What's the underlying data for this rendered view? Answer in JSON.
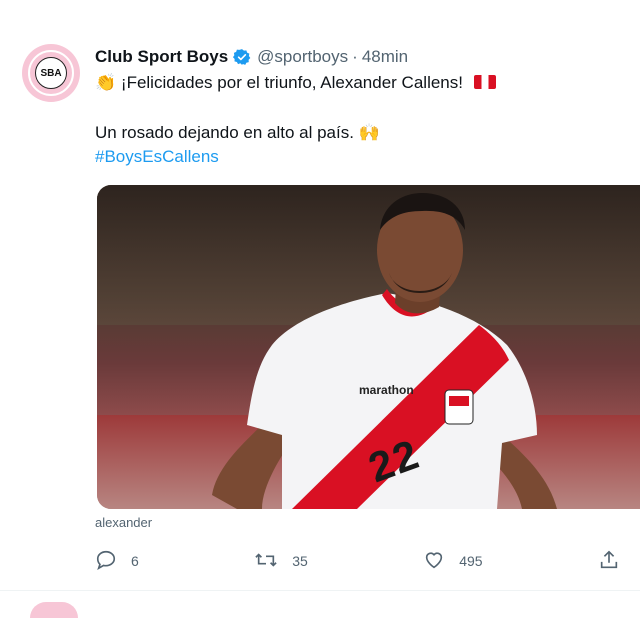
{
  "tweet": {
    "author_name": "Club Sport Boys",
    "handle": "@sportboys",
    "separator": "·",
    "time": "48min",
    "avatar_text": "SBA",
    "line1_emoji": "👏",
    "line1_text": "¡Felicidades por el triunfo, Alexander Callens!",
    "line2_text": "Un rosado dejando en alto al país.",
    "line2_emoji": "🙌",
    "hashtag": "#BoysEsCallens",
    "jersey_sponsor": "marathon",
    "jersey_number": "22",
    "alt_caption": "alexander",
    "replies": "6",
    "retweets": "35",
    "likes": "495"
  },
  "colors": {
    "accent": "#1d9bf0",
    "muted": "#536471",
    "avatar_bg": "#f7c6d6",
    "peru_red": "#d91023"
  },
  "icons": [
    "verified-badge-icon",
    "reply-icon",
    "retweet-icon",
    "like-icon",
    "share-icon",
    "peru-flag-icon"
  ]
}
